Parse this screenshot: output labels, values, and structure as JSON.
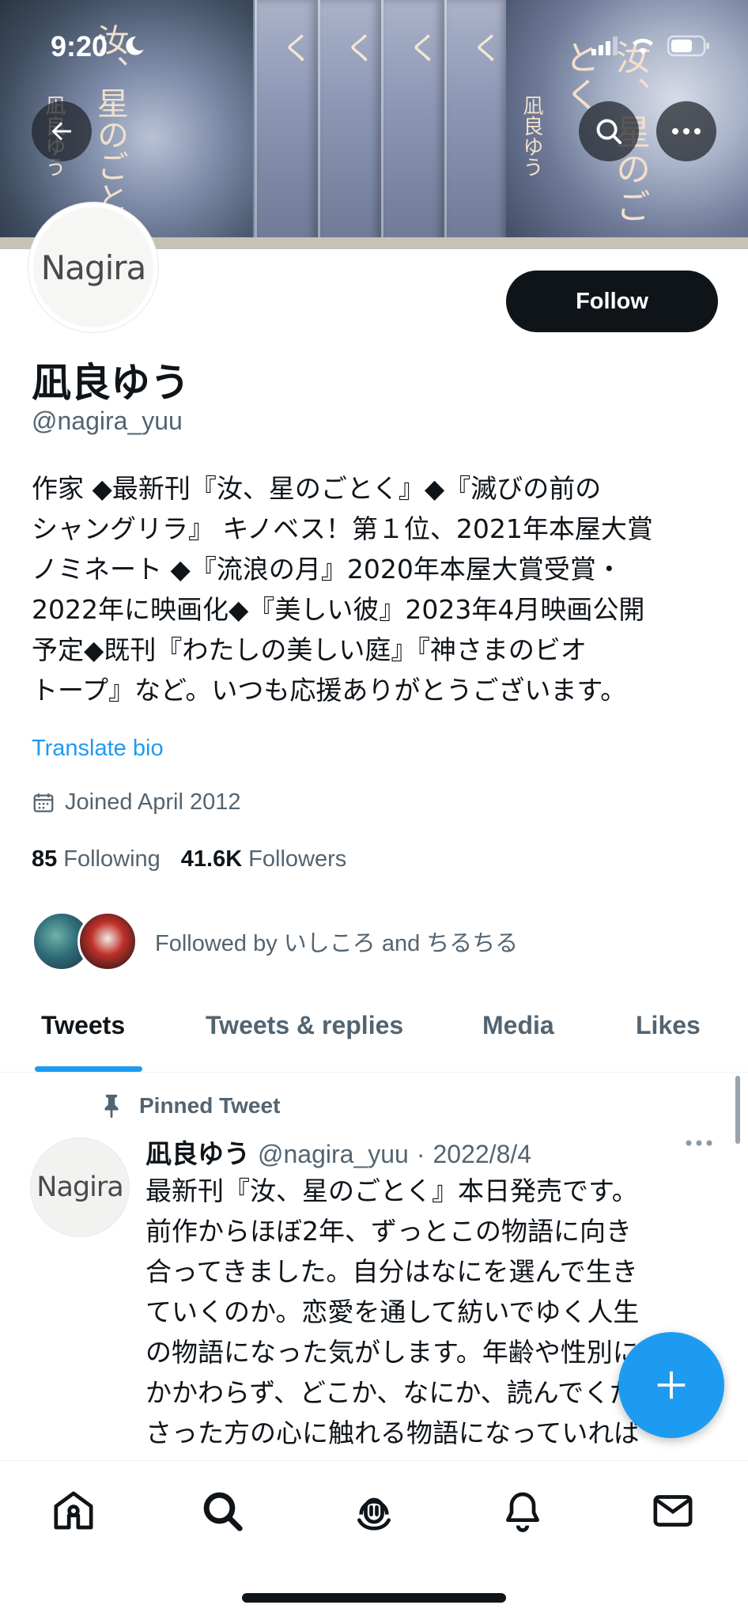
{
  "status_bar": {
    "time": "9:20"
  },
  "profile": {
    "avatar_text": "Nagira",
    "display_name": "凪良ゆう",
    "handle": "@nagira_yuu",
    "bio": "作家 ◆最新刊『汝、星のごとく』◆『滅びの前の\nシャングリラ』 キノベス！第１位、2021年本屋大賞\nノミネート ◆『流浪の月』2020年本屋大賞受賞・\n2022年に映画化◆『美しい彼』2023年4月映画公開\n予定◆既刊『わたしの美しい庭』『神さまのビオ\nトープ』など。いつも応援ありがとうございます。",
    "translate_label": "Translate bio",
    "joined": "Joined April 2012",
    "following_count": "85",
    "following_label": "Following",
    "followers_count": "41.6K",
    "followers_label": "Followers",
    "followed_by": "Followed by いしころ and ちるちる"
  },
  "banner": {
    "book_title": "汝、星のごとく",
    "book_author": "凪良ゆう"
  },
  "actions": {
    "follow_label": "Follow"
  },
  "tabs": [
    {
      "label": "Tweets",
      "active": true
    },
    {
      "label": "Tweets & replies",
      "active": false
    },
    {
      "label": "Media",
      "active": false
    },
    {
      "label": "Likes",
      "active": false
    }
  ],
  "pinned_tweet": {
    "pinned_label": "Pinned Tweet",
    "avatar_text": "Nagira",
    "author": "凪良ゆう",
    "handle": "@nagira_yuu",
    "date": "2022/8/4",
    "text": "最新刊『汝、星のごとく』本日発売です。\n前作からほぼ2年、ずっとこの物語に向き\n合ってきました。自分はなにを選んで生き\nていくのか。恋愛を通して紡いでゆく人生\nの物語になった気がします。年齢や性別に\nかかわらず、どこか、なにか、読んでくだ\nさった方の心に触れる物語になっていれば"
  },
  "colors": {
    "accent": "#1d9bf0",
    "text": "#0f1419",
    "secondary": "#536471"
  },
  "icons": [
    "back-arrow-icon",
    "search-icon",
    "more-icon",
    "calendar-icon",
    "pin-icon",
    "compose-plus-icon",
    "home-icon",
    "explore-search-icon",
    "spaces-icon",
    "notifications-bell-icon",
    "messages-envelope-icon"
  ]
}
